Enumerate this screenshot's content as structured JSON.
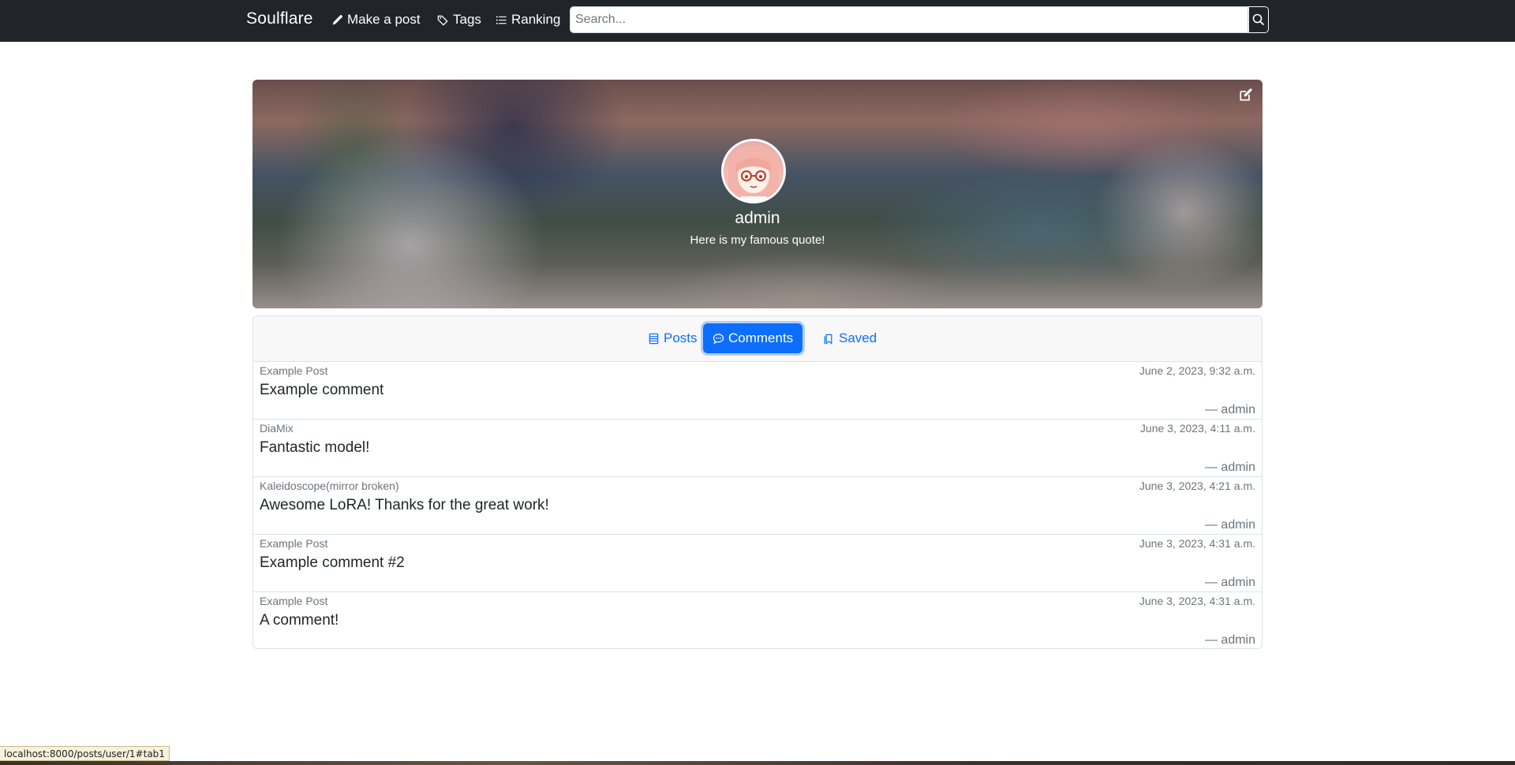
{
  "navbar": {
    "brand": "Soulflare",
    "links": [
      {
        "label": "Make a post",
        "icon": "pencil-icon"
      },
      {
        "label": "Tags",
        "icon": "tags-icon"
      },
      {
        "label": "Ranking",
        "icon": "list-icon"
      }
    ],
    "search_placeholder": "Search...",
    "search_icon": "search-icon"
  },
  "profile": {
    "username": "admin",
    "quote": "Here is my famous quote!",
    "edit_icon": "edit-icon"
  },
  "tabs": [
    {
      "label": "Posts",
      "icon": "list-icon",
      "active": false
    },
    {
      "label": "Comments",
      "icon": "chat-icon",
      "active": true
    },
    {
      "label": "Saved",
      "icon": "bookmark-icon",
      "active": false
    }
  ],
  "comments": [
    {
      "post": "Example Post",
      "date": "June 2, 2023, 9:32 a.m.",
      "text": "Example comment",
      "author": "— admin"
    },
    {
      "post": "DiaMix",
      "date": "June 3, 2023, 4:11 a.m.",
      "text": "Fantastic model!",
      "author": "— admin"
    },
    {
      "post": "Kaleidoscope(mirror broken)",
      "date": "June 3, 2023, 4:21 a.m.",
      "text": "Awesome LoRA! Thanks for the great work!",
      "author": "— admin"
    },
    {
      "post": "Example Post",
      "date": "June 3, 2023, 4:31 a.m.",
      "text": "Example comment #2",
      "author": "— admin"
    },
    {
      "post": "Example Post",
      "date": "June 3, 2023, 4:31 a.m.",
      "text": "A comment!",
      "author": "— admin"
    }
  ],
  "status_bar": {
    "url": "localhost:8000/posts/user/1#tab1"
  },
  "colors": {
    "navbar_bg": "#212529",
    "accent": "#0d6efd",
    "muted_text": "#6c757d"
  }
}
